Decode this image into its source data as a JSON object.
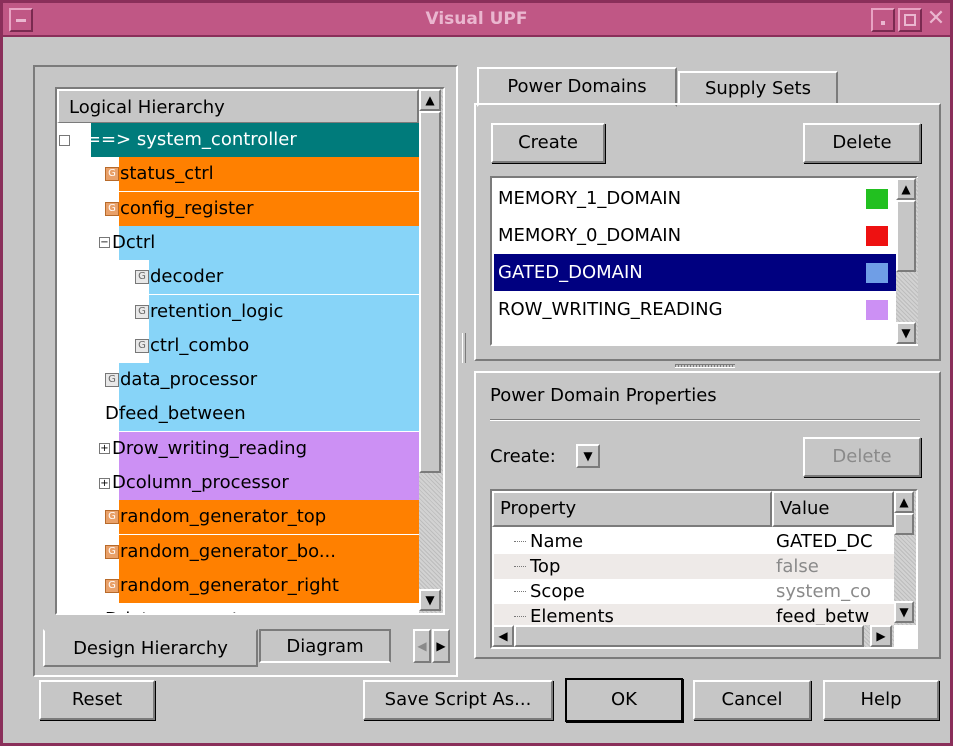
{
  "window": {
    "title": "Visual UPF"
  },
  "left_panel": {
    "tree_header": "Logical Hierarchy",
    "rows": [
      {
        "label": "==> system_controller",
        "indent": 0,
        "icon": "D",
        "expander": "−",
        "bg": "#007b7b",
        "fg": "#ffffff"
      },
      {
        "label": "status_ctrl",
        "indent": 1,
        "icon": "G",
        "bg": "#ff8000"
      },
      {
        "label": "config_register",
        "indent": 1,
        "icon": "G",
        "bg": "#ff8000"
      },
      {
        "label": "ctrl",
        "indent": 1,
        "icon": "D",
        "expander": "−",
        "bg": "#87d4f8"
      },
      {
        "label": "decoder",
        "indent": 2,
        "icon": "G",
        "bg": "#87d4f8"
      },
      {
        "label": "retention_logic",
        "indent": 2,
        "icon": "G",
        "bg": "#87d4f8"
      },
      {
        "label": "ctrl_combo",
        "indent": 2,
        "icon": "G",
        "bg": "#87d4f8"
      },
      {
        "label": "data_processor",
        "indent": 1,
        "icon": "G",
        "bg": "#87d4f8"
      },
      {
        "label": "feed_between",
        "indent": 1,
        "icon": "D",
        "bg": "#87d4f8"
      },
      {
        "label": "row_writing_reading",
        "indent": 1,
        "icon": "D",
        "expander": "+",
        "bg": "#cc90f4"
      },
      {
        "label": "column_processor",
        "indent": 1,
        "icon": "D",
        "expander": "+",
        "bg": "#cc90f4"
      },
      {
        "label": "random_generator_top",
        "indent": 1,
        "icon": "G",
        "bg": "#ff8000"
      },
      {
        "label": "random_generator_bo...",
        "indent": 1,
        "icon": "G",
        "bg": "#ff8000"
      },
      {
        "label": "random_generator_right",
        "indent": 1,
        "icon": "G",
        "bg": "#ff8000"
      },
      {
        "label": "data_generator",
        "indent": 1,
        "icon": "D",
        "bg": "#ffffff"
      }
    ],
    "tabs": [
      "Design Hierarchy",
      "Diagram"
    ]
  },
  "right_panel": {
    "tabs": [
      "Power Domains",
      "Supply Sets"
    ],
    "create_label": "Create",
    "delete_label": "Delete",
    "domains": [
      {
        "name": "MEMORY_1_DOMAIN",
        "color": "#22c020"
      },
      {
        "name": "MEMORY_0_DOMAIN",
        "color": "#ee1111"
      },
      {
        "name": "GATED_DOMAIN",
        "color": "#6f9ee6",
        "selected": true
      },
      {
        "name": "ROW_WRITING_READING",
        "color": "#cc90f4"
      }
    ],
    "props_title": "Power Domain Properties",
    "props_create_label": "Create:",
    "props_delete_label": "Delete",
    "table": {
      "headers": [
        "Property",
        "Value"
      ],
      "rows": [
        {
          "prop": "Name",
          "value": "GATED_DC",
          "gray": false
        },
        {
          "prop": "Top",
          "value": "false",
          "gray": true
        },
        {
          "prop": "Scope",
          "value": "system_co",
          "gray": true
        },
        {
          "prop": "Elements",
          "value": "feed_betw",
          "gray": false
        }
      ]
    }
  },
  "footer": {
    "reset": "Reset",
    "save_script": "Save Script As...",
    "ok": "OK",
    "cancel": "Cancel",
    "help": "Help"
  }
}
